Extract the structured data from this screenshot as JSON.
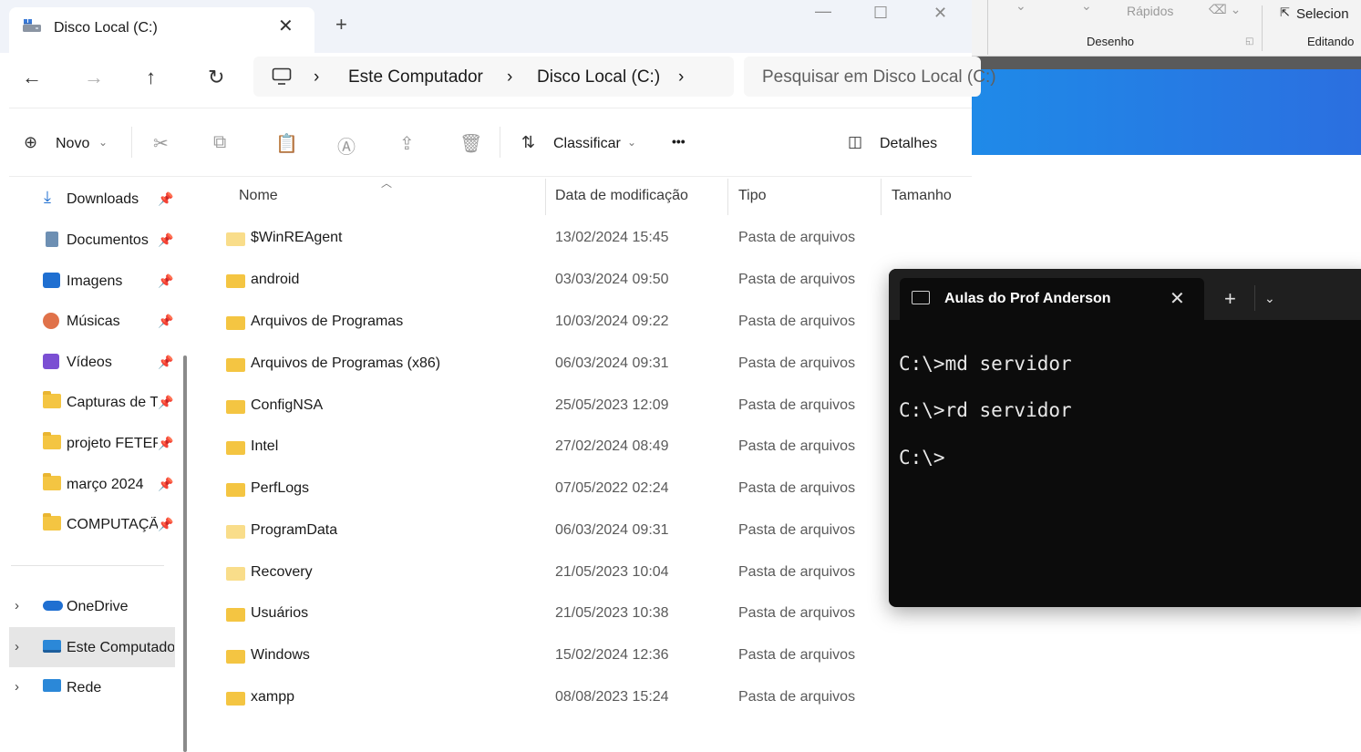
{
  "background_app": {
    "ribbon_fast_label": "Rápidos",
    "ribbon_select_label": "Selecion",
    "group_draw_label": "Desenho",
    "group_edit_label": "Editando"
  },
  "explorer": {
    "tab_title": "Disco Local (C:)",
    "new_tab": "+",
    "breadcrumb": [
      "Este Computador",
      "Disco Local (C:)"
    ],
    "search_placeholder": "Pesquisar em Disco Local (C:)",
    "toolbar": {
      "new_label": "Novo",
      "sort_label": "Classificar",
      "more_label": "•••",
      "details_label": "Detalhes"
    },
    "sidebar": {
      "quick": [
        {
          "label": "Downloads",
          "icon": "download-icon"
        },
        {
          "label": "Documentos",
          "icon": "document-icon"
        },
        {
          "label": "Imagens",
          "icon": "image-icon"
        },
        {
          "label": "Músicas",
          "icon": "music-icon"
        },
        {
          "label": "Vídeos",
          "icon": "video-icon"
        },
        {
          "label": "Capturas de Tela",
          "icon": "folder-icon"
        },
        {
          "label": "projeto FETEPS",
          "icon": "folder-icon"
        },
        {
          "label": "março 2024",
          "icon": "folder-icon"
        },
        {
          "label": "COMPUTAÇÃO",
          "icon": "folder-icon"
        }
      ],
      "locations": [
        {
          "label": "OneDrive",
          "icon": "cloud-icon"
        },
        {
          "label": "Este Computador",
          "icon": "computer-icon"
        },
        {
          "label": "Rede",
          "icon": "network-icon"
        }
      ]
    },
    "columns": {
      "name": "Nome",
      "date": "Data de modificação",
      "type": "Tipo",
      "size": "Tamanho"
    },
    "files": [
      {
        "name": "$WinREAgent",
        "date": "13/02/2024 15:45",
        "type": "Pasta de arquivos"
      },
      {
        "name": "android",
        "date": "03/03/2024 09:50",
        "type": "Pasta de arquivos"
      },
      {
        "name": "Arquivos de Programas",
        "date": "10/03/2024 09:22",
        "type": "Pasta de arquivos"
      },
      {
        "name": "Arquivos de Programas (x86)",
        "date": "06/03/2024 09:31",
        "type": "Pasta de arquivos"
      },
      {
        "name": "ConfigNSA",
        "date": "25/05/2023 12:09",
        "type": "Pasta de arquivos"
      },
      {
        "name": "Intel",
        "date": "27/02/2024 08:49",
        "type": "Pasta de arquivos"
      },
      {
        "name": "PerfLogs",
        "date": "07/05/2022 02:24",
        "type": "Pasta de arquivos"
      },
      {
        "name": "ProgramData",
        "date": "06/03/2024 09:31",
        "type": "Pasta de arquivos"
      },
      {
        "name": "Recovery",
        "date": "21/05/2023 10:04",
        "type": "Pasta de arquivos"
      },
      {
        "name": "Usuários",
        "date": "21/05/2023 10:38",
        "type": "Pasta de arquivos"
      },
      {
        "name": "Windows",
        "date": "15/02/2024 12:36",
        "type": "Pasta de arquivos"
      },
      {
        "name": "xampp",
        "date": "08/08/2023 15:24",
        "type": "Pasta de arquivos"
      }
    ]
  },
  "terminal": {
    "tab_title": "Aulas do Prof Anderson",
    "lines": [
      "C:\\>md servidor",
      "C:\\>rd servidor",
      "C:\\>"
    ]
  },
  "colors": {
    "folder": "#f4c542",
    "terminal_bg": "#0c0c0c",
    "accent_blue": "#1f8ae8"
  }
}
